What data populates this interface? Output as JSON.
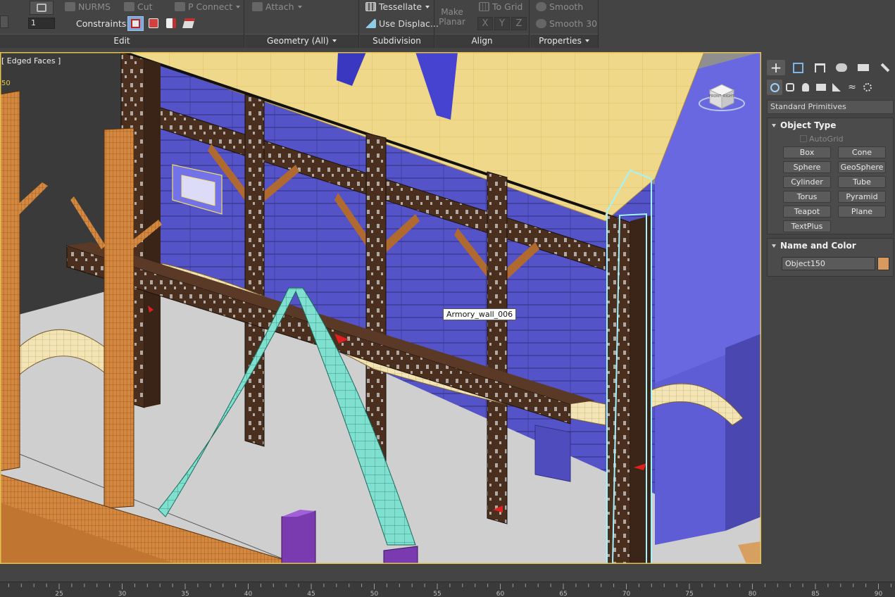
{
  "ribbon": {
    "edit": {
      "nurms": "NURMS",
      "cut": "Cut",
      "p_connect": "P Connect",
      "constraints_label": "Constraints:",
      "spinner_value": "1",
      "footer": "Edit"
    },
    "geometry": {
      "attach": "Attach",
      "footer": "Geometry (All)"
    },
    "subdivision": {
      "tessellate": "Tessellate",
      "use_displace": "Use Displac...",
      "footer": "Subdivision"
    },
    "align": {
      "make_planar_1": "Make",
      "make_planar_2": "Planar",
      "to_grid": "To Grid",
      "x": "X",
      "y": "Y",
      "z": "Z",
      "footer": "Align"
    },
    "properties": {
      "smooth": "Smooth",
      "smooth30": "Smooth 30",
      "footer": "Properties"
    }
  },
  "viewport": {
    "label": "[ Edged Faces ]",
    "corner_value": "50",
    "tooltip": "Armory_wall_006",
    "viewcube_front": "FRONT",
    "viewcube_right": "RIGHT"
  },
  "command_panel": {
    "tabs": [
      "create-tab",
      "modify-tab",
      "hierarchy-tab",
      "motion-tab",
      "display-tab",
      "utilities-tab"
    ],
    "categories": [
      "geometry",
      "shapes",
      "lights",
      "cameras",
      "helpers",
      "space-warps",
      "systems"
    ],
    "dropdown": "Standard Primitives",
    "object_type": {
      "title": "Object Type",
      "autogrid": "AutoGrid",
      "buttons": [
        "Box",
        "Cone",
        "Sphere",
        "GeoSphere",
        "Cylinder",
        "Tube",
        "Torus",
        "Pyramid",
        "Teapot",
        "Plane",
        "TextPlus"
      ]
    },
    "name_and_color": {
      "title": "Name and Color",
      "name": "Object150",
      "color": "#d99a5f"
    }
  },
  "timeline": {
    "labels": [
      "25",
      "30",
      "35",
      "40",
      "45",
      "50",
      "55",
      "60",
      "65",
      "70",
      "75",
      "80",
      "85",
      "90"
    ]
  }
}
